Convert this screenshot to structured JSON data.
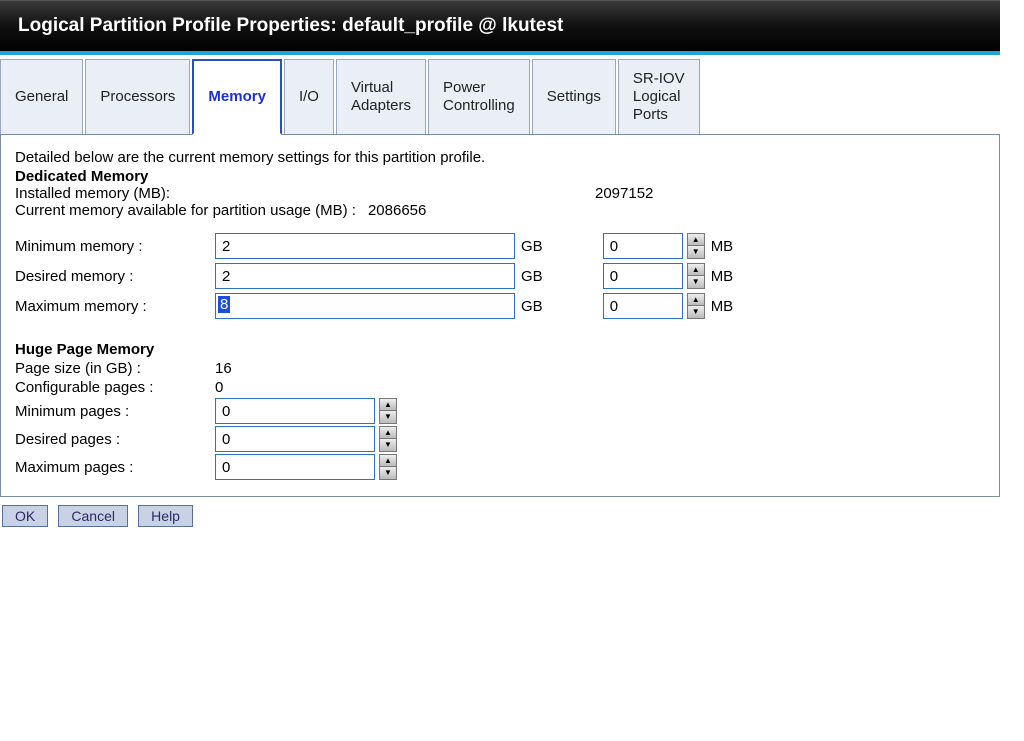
{
  "title": "Logical Partition Profile Properties: default_profile @ lkutest",
  "tabs": [
    {
      "label": "General"
    },
    {
      "label": "Processors"
    },
    {
      "label": "Memory"
    },
    {
      "label": "I/O"
    },
    {
      "label": "Virtual\nAdapters"
    },
    {
      "label": "Power\nControlling"
    },
    {
      "label": "Settings"
    },
    {
      "label": "SR-IOV\nLogical\nPorts"
    }
  ],
  "active_tab": 2,
  "intro_text": "Detailed below are the current memory settings for this partition profile.",
  "dedicated": {
    "heading": "Dedicated Memory",
    "installed_label": "Installed memory (MB):",
    "installed_value": "2097152",
    "available_label": "Current memory available for partition usage (MB) :",
    "available_value": "2086656",
    "rows": [
      {
        "label": "Minimum memory :",
        "gb": "2",
        "mb": "0"
      },
      {
        "label": "Desired memory :",
        "gb": "2",
        "mb": "0"
      },
      {
        "label": "Maximum memory :",
        "gb": "8",
        "mb": "0",
        "gb_selected": true
      }
    ],
    "gb_unit": "GB",
    "mb_unit": "MB"
  },
  "huge": {
    "heading": "Huge Page Memory",
    "page_size_label": "Page size (in GB) :",
    "page_size_value": "16",
    "config_label": "Configurable pages :",
    "config_value": "0",
    "rows": [
      {
        "label": "Minimum pages :",
        "val": "0"
      },
      {
        "label": "Desired pages :",
        "val": "0"
      },
      {
        "label": "Maximum pages :",
        "val": "0"
      }
    ]
  },
  "buttons": {
    "ok": "OK",
    "cancel": "Cancel",
    "help": "Help"
  }
}
